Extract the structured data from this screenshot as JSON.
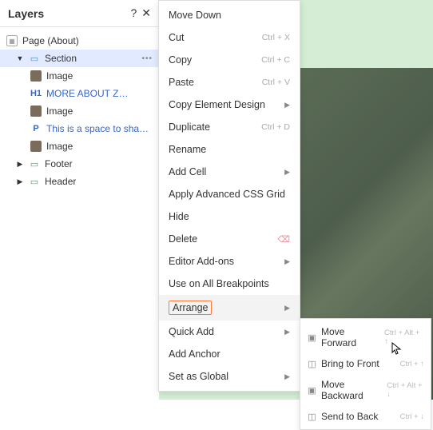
{
  "panel": {
    "title": "Layers",
    "page_label": "Page (About)",
    "section_label": "Section",
    "items": [
      {
        "label": "Image",
        "type": "thumb"
      },
      {
        "prefix": "H1",
        "label": "MORE ABOUT Z…",
        "type": "text"
      },
      {
        "label": "Image",
        "type": "thumb"
      },
      {
        "prefix": "P",
        "label": "This is a space to sha…",
        "type": "text"
      },
      {
        "label": "Image",
        "type": "thumb"
      }
    ],
    "footer": "Footer",
    "header": "Header"
  },
  "menu": {
    "move_down": "Move Down",
    "cut": "Cut",
    "cut_sc": "Ctrl + X",
    "copy": "Copy",
    "copy_sc": "Ctrl + C",
    "paste": "Paste",
    "paste_sc": "Ctrl + V",
    "copy_design": "Copy Element Design",
    "duplicate": "Duplicate",
    "duplicate_sc": "Ctrl + D",
    "rename": "Rename",
    "add_cell": "Add Cell",
    "css_grid": "Apply Advanced CSS Grid",
    "hide": "Hide",
    "delete": "Delete",
    "addons": "Editor Add-ons",
    "breakpoints": "Use on All Breakpoints",
    "arrange": "Arrange",
    "quick_add": "Quick Add",
    "add_anchor": "Add Anchor",
    "set_global": "Set as Global"
  },
  "submenu": {
    "fwd": "Move Forward",
    "fwd_sc": "Ctrl + Alt + ↑",
    "front": "Bring to Front",
    "front_sc": "Ctrl + ↑",
    "bwd": "Move Backward",
    "bwd_sc": "Ctrl + Alt + ↓",
    "back": "Send to Back",
    "back_sc": "Ctrl + ↓"
  }
}
